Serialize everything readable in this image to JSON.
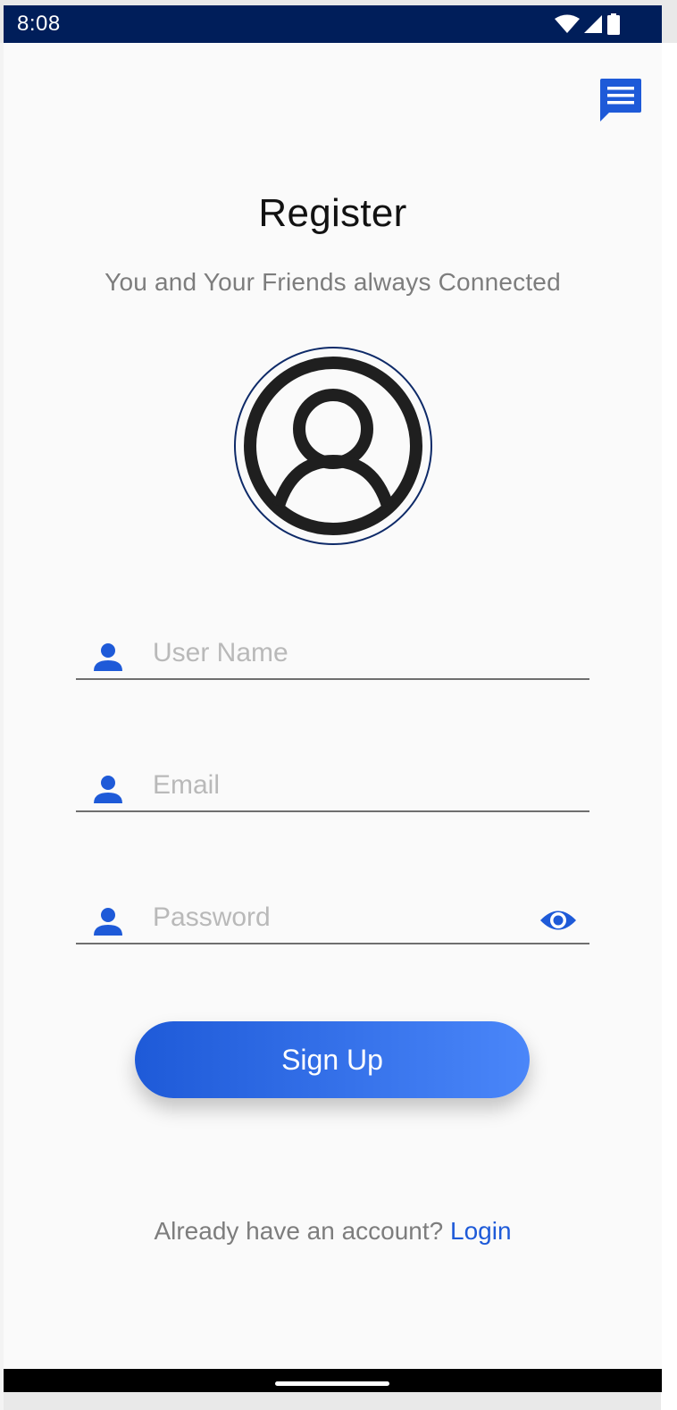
{
  "status_bar": {
    "time": "8:08",
    "icons": [
      "wifi-icon",
      "signal-icon",
      "battery-icon"
    ],
    "background": "#001e5a"
  },
  "header": {
    "chat_icon": "chat-icon"
  },
  "title": "Register",
  "subtitle": "You and Your Friends always Connected",
  "avatar": {
    "icon": "account-circle-icon"
  },
  "form": {
    "username": {
      "placeholder": "User Name",
      "value": "",
      "icon": "person-icon"
    },
    "email": {
      "placeholder": "Email",
      "value": "",
      "icon": "person-icon"
    },
    "password": {
      "placeholder": "Password",
      "value": "",
      "icon": "person-icon",
      "toggle_icon": "eye-icon"
    }
  },
  "signup_label": "Sign Up",
  "footer": {
    "prompt": "Already have an account?",
    "link": "Login"
  },
  "colors": {
    "accent": "#1e5ad8",
    "accent_light": "#4a86f9",
    "status_bar": "#001e5a",
    "text_muted": "#7d7d7d",
    "placeholder": "#b9b9b9"
  }
}
